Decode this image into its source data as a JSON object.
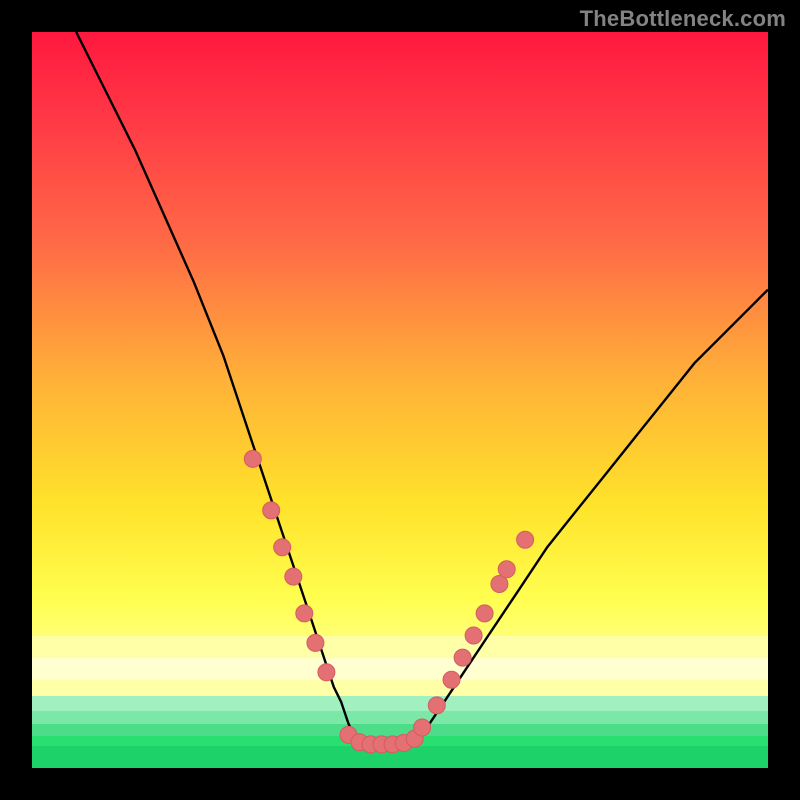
{
  "watermark": "TheBottleneck.com",
  "colors": {
    "frame": "#000000",
    "curve": "#000000",
    "marker_fill": "#e37072",
    "marker_stroke": "#d65b62",
    "grad_top": "#ff183f",
    "grad_bottom": "#ffff74",
    "band_pale_yellow": "#ffffa8",
    "band_cream": "#ffffd0",
    "band_mint": "#a0f0c0",
    "band_green": "#28e070",
    "band_green2": "#1cd269"
  },
  "chart_data": {
    "type": "line",
    "title": "",
    "xlabel": "",
    "ylabel": "",
    "xlim": [
      0,
      100
    ],
    "ylim": [
      0,
      100
    ],
    "grid": false,
    "legend": false,
    "series": [
      {
        "name": "bottleneck-curve",
        "x": [
          6,
          10,
          14,
          18,
          22,
          26,
          28,
          30,
          32,
          34,
          36,
          38,
          40,
          41,
          42,
          43,
          44,
          45,
          46,
          47,
          48,
          51,
          52,
          54,
          56,
          58,
          60,
          62,
          66,
          70,
          74,
          78,
          82,
          86,
          90,
          94,
          98,
          100
        ],
        "y": [
          100,
          92,
          84,
          75,
          66,
          56,
          50,
          44,
          38,
          32,
          26,
          20,
          14,
          11,
          9,
          6,
          4,
          3,
          3,
          3,
          3,
          3,
          4,
          6,
          9,
          12,
          15,
          18,
          24,
          30,
          35,
          40,
          45,
          50,
          55,
          59,
          63,
          65
        ]
      }
    ],
    "markers": {
      "name": "hardware-points",
      "points": [
        {
          "x": 30.0,
          "y": 42
        },
        {
          "x": 32.5,
          "y": 35
        },
        {
          "x": 34.0,
          "y": 30
        },
        {
          "x": 35.5,
          "y": 26
        },
        {
          "x": 37.0,
          "y": 21
        },
        {
          "x": 38.5,
          "y": 17
        },
        {
          "x": 40.0,
          "y": 13
        },
        {
          "x": 43.0,
          "y": 4.5
        },
        {
          "x": 44.5,
          "y": 3.5
        },
        {
          "x": 46.0,
          "y": 3.2
        },
        {
          "x": 47.5,
          "y": 3.2
        },
        {
          "x": 49.0,
          "y": 3.2
        },
        {
          "x": 50.5,
          "y": 3.4
        },
        {
          "x": 52.0,
          "y": 4.0
        },
        {
          "x": 53.0,
          "y": 5.5
        },
        {
          "x": 55.0,
          "y": 8.5
        },
        {
          "x": 57.0,
          "y": 12
        },
        {
          "x": 58.5,
          "y": 15
        },
        {
          "x": 60.0,
          "y": 18
        },
        {
          "x": 61.5,
          "y": 21
        },
        {
          "x": 63.5,
          "y": 25
        },
        {
          "x": 64.5,
          "y": 27
        },
        {
          "x": 67.0,
          "y": 31
        }
      ]
    }
  }
}
